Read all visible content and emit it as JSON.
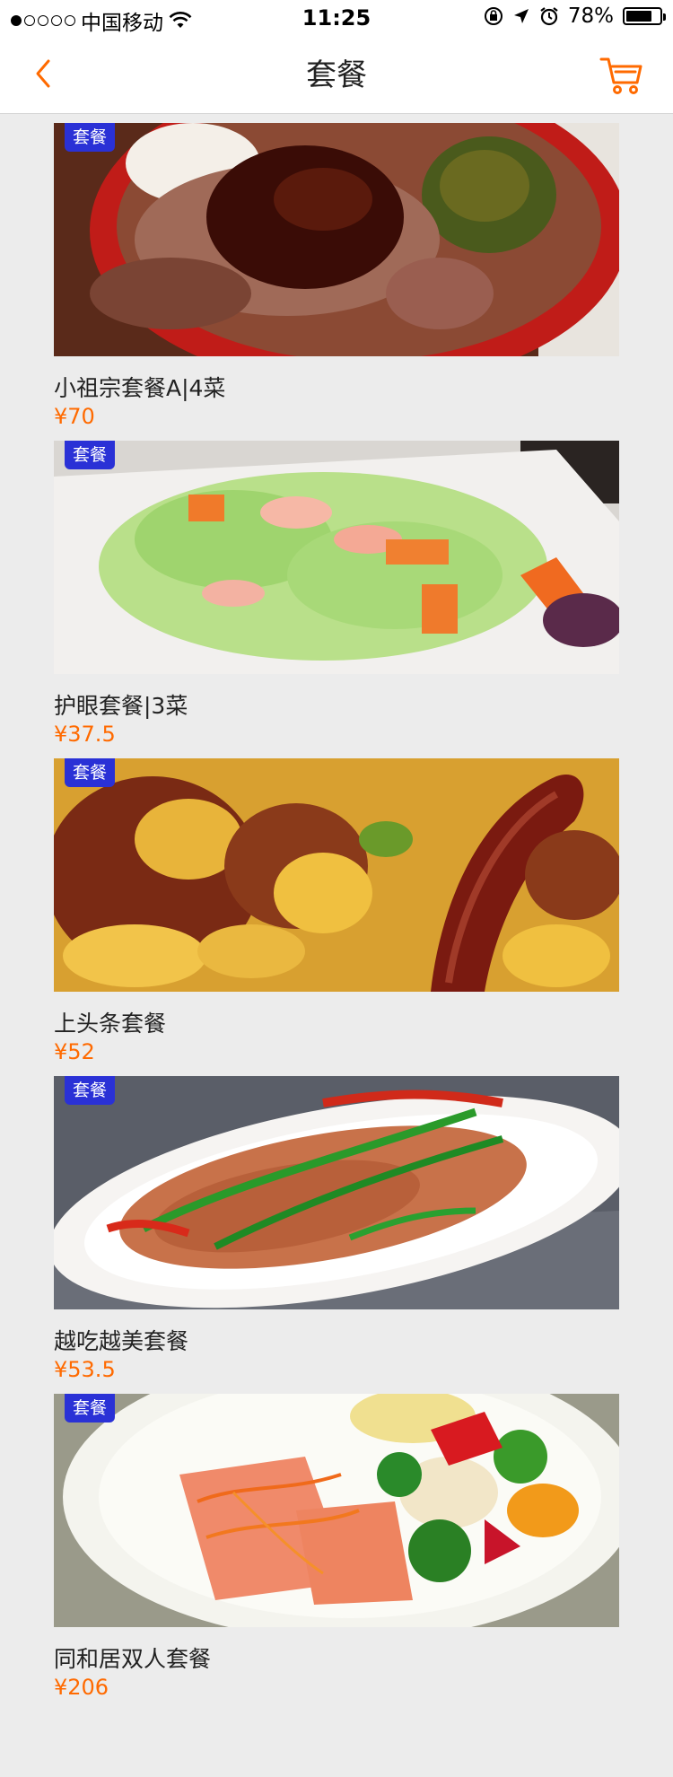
{
  "status_bar": {
    "carrier": "中国移动",
    "time": "11:25",
    "battery": "78%",
    "battery_level": 0.78,
    "signal_dots_filled": 1,
    "signal_dots_total": 5,
    "icons": [
      "wifi-icon",
      "rotation-lock-icon",
      "location-arrow-icon",
      "alarm-icon",
      "battery-icon"
    ]
  },
  "header": {
    "title": "套餐",
    "back_icon": "chevron-left-icon",
    "cart_icon": "cart-icon",
    "accent_color": "#ff6a00"
  },
  "colors": {
    "tag_bg": "#2a31d6",
    "price": "#ff6a00",
    "background": "#ececec"
  },
  "items": [
    {
      "tag": "套餐",
      "name": "小祖宗套餐A|4菜",
      "price": "¥70"
    },
    {
      "tag": "套餐",
      "name": "护眼套餐|3菜",
      "price": "¥37.5"
    },
    {
      "tag": "套餐",
      "name": "上头条套餐",
      "price": "¥52"
    },
    {
      "tag": "套餐",
      "name": "越吃越美套餐",
      "price": "¥53.5"
    },
    {
      "tag": "套餐",
      "name": "同和居双人套餐",
      "price": "¥206"
    }
  ]
}
